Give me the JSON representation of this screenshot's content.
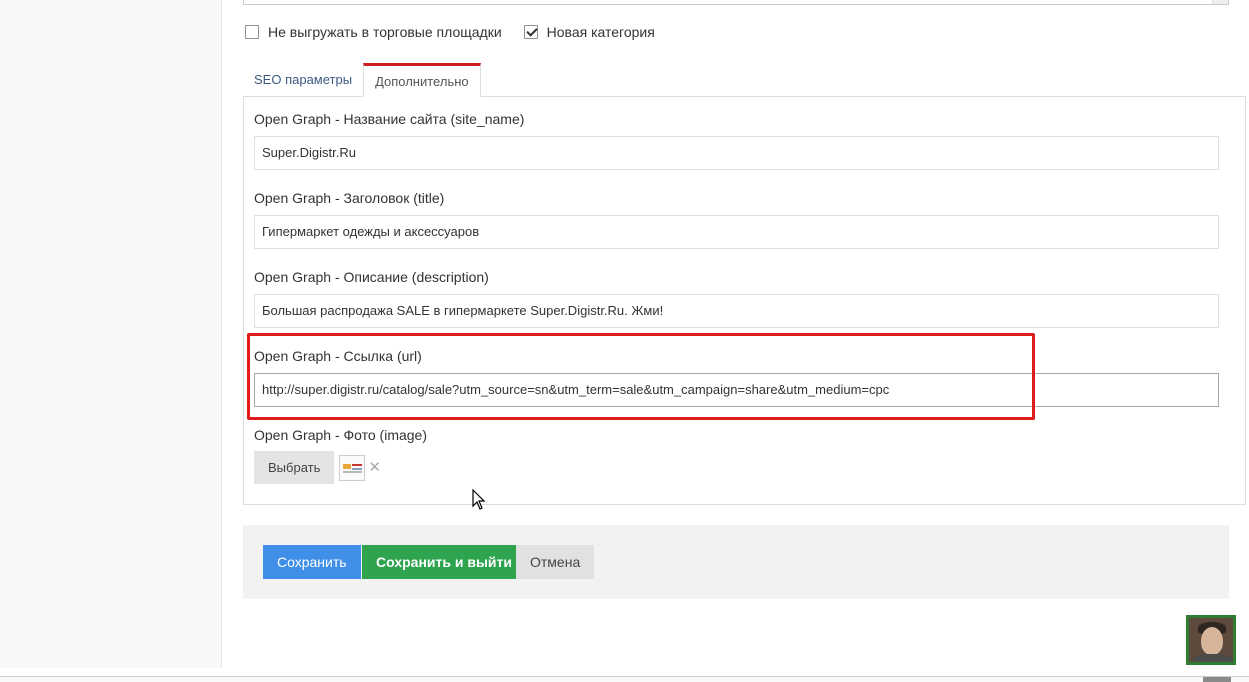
{
  "checkboxes": [
    {
      "label": "Не выгружать в торговые площадки",
      "checked": false
    },
    {
      "label": "Новая категория",
      "checked": true
    }
  ],
  "tabs": [
    {
      "label": "SEO параметры",
      "active": false
    },
    {
      "label": "Дополнительно",
      "active": true
    }
  ],
  "fields": {
    "site_name": {
      "label": "Open Graph - Название сайта (site_name)",
      "value": "Super.Digistr.Ru"
    },
    "title": {
      "label": "Open Graph - Заголовок (title)",
      "value": "Гипермаркет одежды и аксессуаров"
    },
    "description": {
      "label": "Open Graph - Описание (description)",
      "value": "Большая распродажа SALE в гипермаркете Super.Digistr.Ru. Жми!"
    },
    "url": {
      "label": "Open Graph - Ссылка (url)",
      "value": "http://super.digistr.ru/catalog/sale?utm_source=sn&utm_term=sale&utm_campaign=share&utm_medium=cpc"
    },
    "image": {
      "label": "Open Graph - Фото (image)",
      "choose_label": "Выбрать",
      "remove_label": "✕"
    }
  },
  "actions": {
    "save": "Сохранить",
    "save_exit": "Сохранить и выйти",
    "cancel": "Отмена"
  },
  "colors": {
    "highlight": "#e01b1b",
    "active_tab_top": "#cc1f1f",
    "save": "#3f8ee8",
    "save_exit": "#2ea44f"
  },
  "icons": {
    "image_thumbnail": "image-thumbnail-icon",
    "remove": "close-icon",
    "cursor": "mouse-cursor-icon",
    "checkbox_check": "check-icon"
  }
}
